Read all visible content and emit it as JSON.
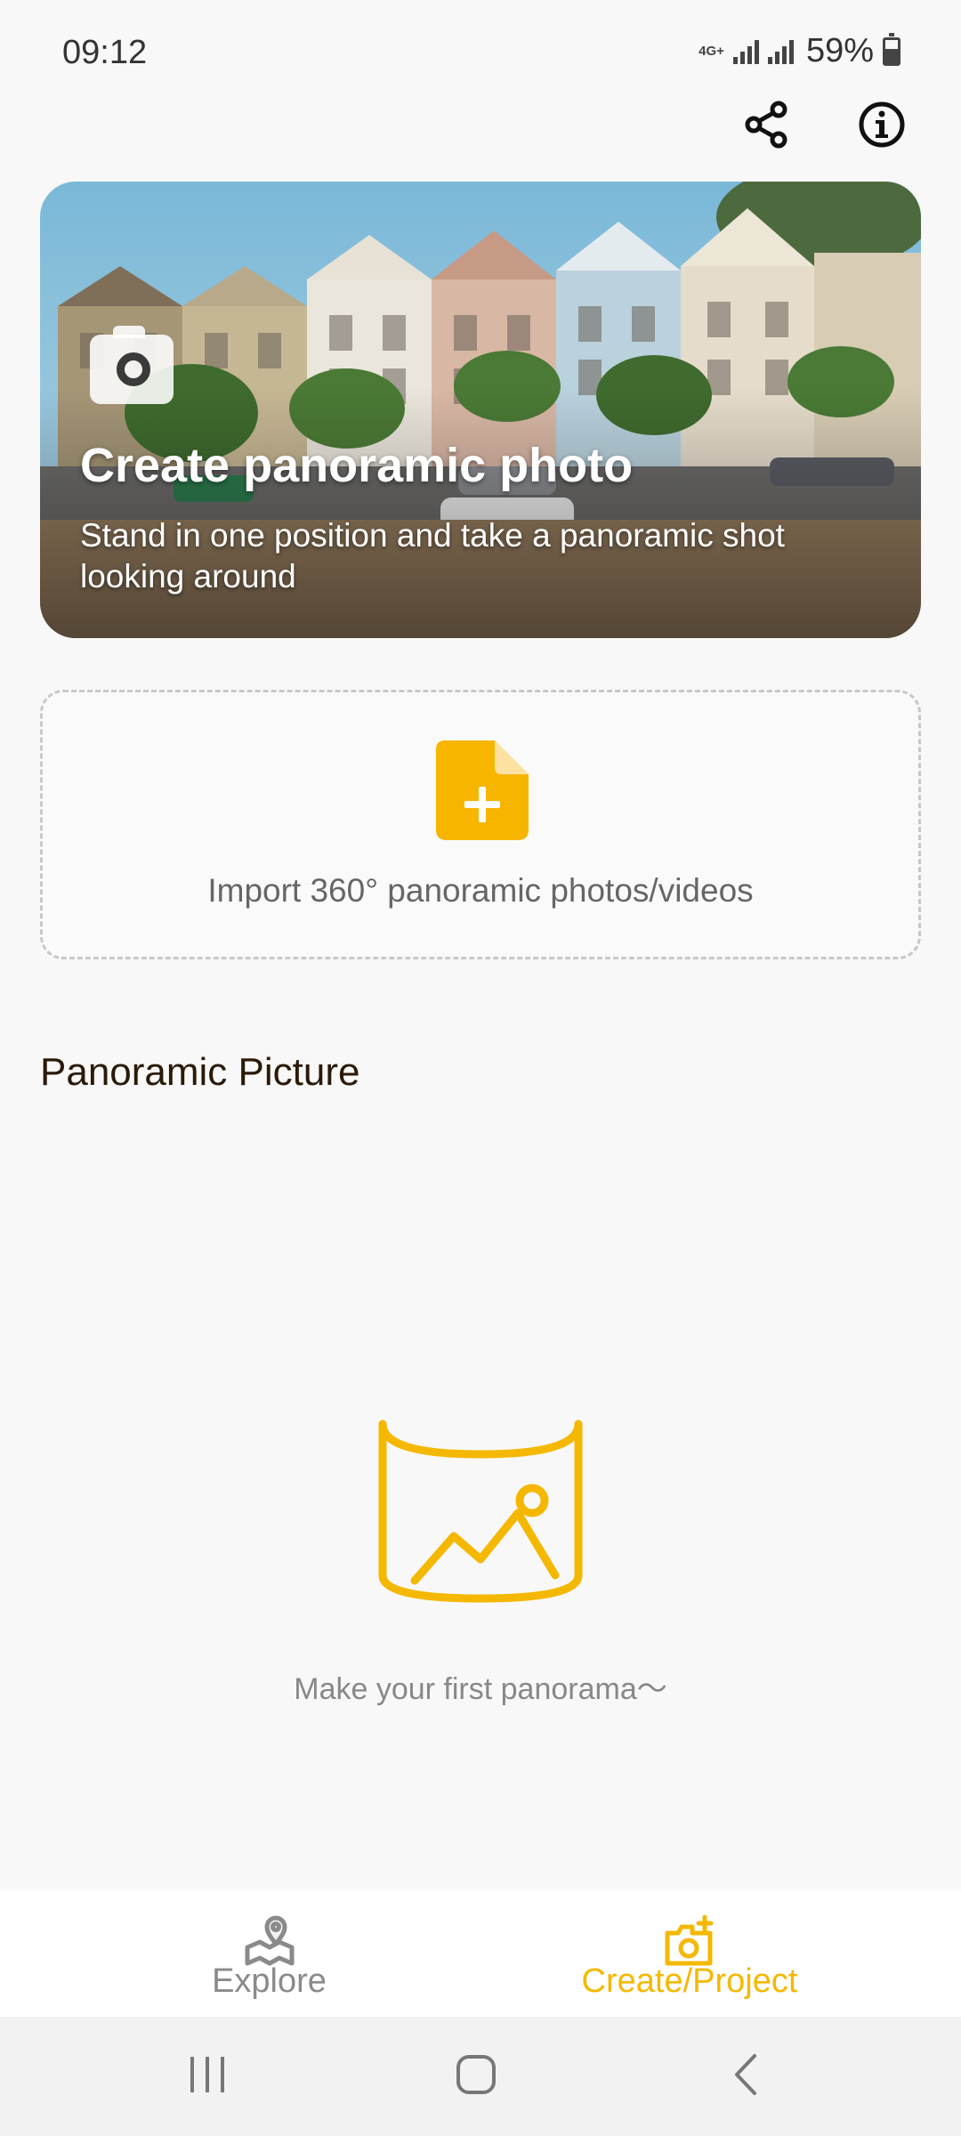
{
  "status_bar": {
    "time": "09:12",
    "network": "4G+",
    "battery": "59%",
    "battery_level": 0.59
  },
  "toolbar": {
    "share_icon": "share-icon",
    "info_icon": "info-icon"
  },
  "hero": {
    "title": "Create panoramic photo",
    "subtitle": "Stand in one position and take a panoramic shot looking around",
    "icon": "camera-icon"
  },
  "import": {
    "label": "Import 360° panoramic photos/videos",
    "icon": "add-file-icon"
  },
  "section": {
    "title": "Panoramic Picture"
  },
  "empty_state": {
    "icon": "panorama-icon",
    "text": "Make your first panorama～"
  },
  "bottom_nav": {
    "items": [
      {
        "label": "Explore",
        "icon": "map-pin-icon",
        "active": false
      },
      {
        "label": "Create/Project",
        "icon": "camera-add-icon",
        "active": true
      }
    ]
  },
  "system_nav": {
    "recents_icon": "recents-icon",
    "home_icon": "home-icon",
    "back_icon": "back-icon"
  },
  "colors": {
    "accent": "#f5b800",
    "background": "#f8f8f8",
    "inactive": "#8a8a8a"
  }
}
